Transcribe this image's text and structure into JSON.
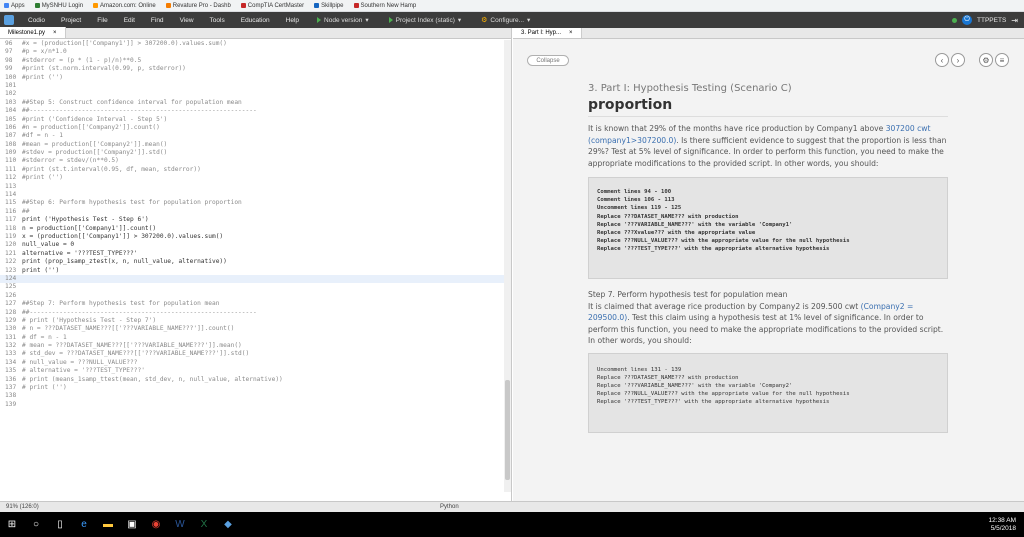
{
  "bookmarks": [
    {
      "label": "Apps",
      "color": "#4285f4"
    },
    {
      "label": "MySNHU Login",
      "color": "#2e7d32"
    },
    {
      "label": "Amazon.com: Online",
      "color": "#ff9900"
    },
    {
      "label": "Revature Pro - Dashb",
      "color": "#f57c00"
    },
    {
      "label": "CompTIA CertMaster",
      "color": "#c62828"
    },
    {
      "label": "Skillpipe",
      "color": "#1565c0"
    },
    {
      "label": "Southern New Hamp",
      "color": "#c62828"
    }
  ],
  "menubar": {
    "items": [
      "Codio",
      "Project",
      "File",
      "Edit",
      "Find",
      "View",
      "Tools",
      "Education",
      "Help"
    ],
    "node_version": "Node version",
    "project_index": "Project Index (static)",
    "configure": "Configure...",
    "user": "TTPPETS"
  },
  "editor": {
    "tab_name": "Milestone1.py",
    "close_glyph": "×",
    "lines": [
      {
        "n": "96",
        "t": "#x = (production[['Company1']] > 307200.0).values.sum()",
        "cm": true
      },
      {
        "n": "97",
        "t": "#p = x/n*1.0",
        "cm": true
      },
      {
        "n": "98",
        "t": "#stderror = (p * (1 - p)/n)**0.5",
        "cm": true
      },
      {
        "n": "99",
        "t": "#print (st.norm.interval(0.99, p, stderror))",
        "cm": true
      },
      {
        "n": "100",
        "t": "#print ('')",
        "cm": true
      },
      {
        "n": "101",
        "t": "",
        "cm": true
      },
      {
        "n": "102",
        "t": "",
        "cm": true
      },
      {
        "n": "103",
        "t": "##Step 5: Construct confidence interval for population mean",
        "cm": true
      },
      {
        "n": "104",
        "t": "##-------------------------------------------------------------",
        "cm": true
      },
      {
        "n": "105",
        "t": "#print ('Confidence Interval - Step 5')",
        "cm": true
      },
      {
        "n": "106",
        "t": "#n = production[['Company2']].count()",
        "cm": true
      },
      {
        "n": "107",
        "t": "#df = n - 1",
        "cm": true
      },
      {
        "n": "108",
        "t": "#mean = production[['Company2']].mean()",
        "cm": true
      },
      {
        "n": "109",
        "t": "#stdev = production[['Company2']].std()",
        "cm": true
      },
      {
        "n": "110",
        "t": "#stderror = stdev/(n**0.5)",
        "cm": true
      },
      {
        "n": "111",
        "t": "#print (st.t.interval(0.95, df, mean, stderror))",
        "cm": true
      },
      {
        "n": "112",
        "t": "#print ('')",
        "cm": true
      },
      {
        "n": "113",
        "t": "",
        "cm": true
      },
      {
        "n": "114",
        "t": "",
        "cm": true
      },
      {
        "n": "115",
        "t": "##Step 6: Perform hypothesis test for population proportion",
        "cm": true
      },
      {
        "n": "116",
        "t": "##",
        "cm": true
      },
      {
        "n": "117",
        "t": "print ('Hypothesis Test - Step 6')",
        "cm": false
      },
      {
        "n": "118",
        "t": "n = production[['Company1']].count()",
        "cm": false
      },
      {
        "n": "119",
        "t": "x = (production[['Company1']] > 307200.0).values.sum()",
        "cm": false
      },
      {
        "n": "120",
        "t": "null_value = 0",
        "cm": false
      },
      {
        "n": "121",
        "t": "alternative = '???TEST_TYPE???'",
        "cm": false
      },
      {
        "n": "122",
        "t": "print (prop_1samp_ztest(x, n, null_value, alternative))",
        "cm": false
      },
      {
        "n": "123",
        "t": "print ('')",
        "cm": false
      },
      {
        "n": "124",
        "t": "",
        "cm": false,
        "active": true
      },
      {
        "n": "125",
        "t": "",
        "cm": false
      },
      {
        "n": "126",
        "t": "",
        "cm": true
      },
      {
        "n": "127",
        "t": "##Step 7: Perform hypothesis test for population mean",
        "cm": true
      },
      {
        "n": "128",
        "t": "##-------------------------------------------------------------",
        "cm": true
      },
      {
        "n": "129",
        "t": "# print ('Hypothesis Test - Step 7')",
        "cm": true
      },
      {
        "n": "130",
        "t": "# n = ???DATASET_NAME???[['???VARIABLE_NAME???']].count()",
        "cm": true
      },
      {
        "n": "131",
        "t": "# df = n - 1",
        "cm": true
      },
      {
        "n": "132",
        "t": "# mean = ???DATASET_NAME???[['???VARIABLE_NAME???']].mean()",
        "cm": true
      },
      {
        "n": "133",
        "t": "# std_dev = ???DATASET_NAME???[['???VARIABLE_NAME???']].std()",
        "cm": true
      },
      {
        "n": "134",
        "t": "# null_value = ???NULL_VALUE???",
        "cm": true
      },
      {
        "n": "135",
        "t": "# alternative = '???TEST_TYPE???'",
        "cm": true
      },
      {
        "n": "136",
        "t": "# print (means_1samp_ttest(mean, std_dev, n, null_value, alternative))",
        "cm": true
      },
      {
        "n": "137",
        "t": "# print ('')",
        "cm": true
      },
      {
        "n": "138",
        "t": "",
        "cm": true
      },
      {
        "n": "139",
        "t": "",
        "cm": true
      }
    ]
  },
  "statusbar": {
    "position": "91% (126:0)",
    "language": "Python"
  },
  "preview": {
    "tab_name": "3. Part I: Hyp...",
    "close_glyph": "×",
    "collapse_label": "Collapse",
    "subtitle": "3. Part I: Hypothesis Testing (Scenario C)",
    "title": "proportion",
    "para1_a": "It is known that 29% of the months have rice production by Company1 above ",
    "para1_ref": "307200 cwt (company1>307200.0)",
    "para1_b": ". Is there sufficient evidence to suggest that the proportion is less than 29%? Test at 5% level of significance. In order to perform this function, you need to make the appropriate modifications to the provided script. In other words, you should:",
    "box1": "Comment lines 94 - 100\nComment lines 106 - 113\nUncomment lines 119 - 125\nReplace ???DATASET_NAME??? with production\nReplace '???VARIABLE_NAME???' with the variable 'Company1'\nReplace ???Xvalue??? with the appropriate value\nReplace ???NULL_VALUE??? with the appropriate value for the null hypothesis\nReplace '???TEST_TYPE???' with the appropriate alternative hypothesis",
    "para2": "Step 7. Perform hypothesis test for population mean",
    "para3_a": "It is claimed that average rice production by Company2 is 209.500 cwt ",
    "para3_ref": "(Company2 = 209500.0)",
    "para3_b": ". Test this claim using a hypothesis test at 1% level of significance. In order to perform this function, you need to make the appropriate modifications to the provided script. In other words, you should:",
    "box2": "Uncomment lines 131 - 139\nReplace ???DATASET_NAME??? with production\nReplace '???VARIABLE_NAME???' with the variable 'Company2'\nReplace ???NULL_VALUE??? with the appropriate value for the null hypothesis\nReplace '???TEST_TYPE???' with the appropriate alternative hypothesis"
  },
  "taskbar": {
    "icons": [
      "windows-icon",
      "search-icon",
      "task-view-icon",
      "edge-icon",
      "file-explorer-icon",
      "store-icon",
      "chrome-icon",
      "word-icon",
      "excel-icon",
      "app-icon"
    ],
    "time": "12:38 AM",
    "date": "5/5/2018"
  }
}
